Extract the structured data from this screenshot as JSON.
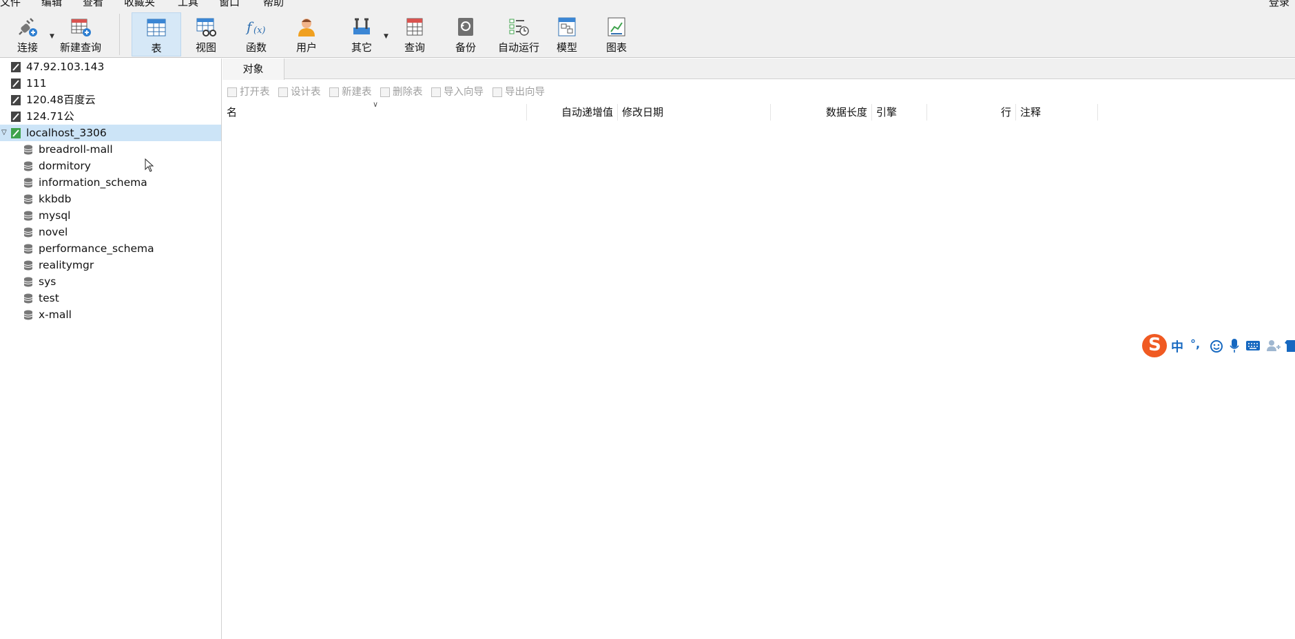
{
  "menu": {
    "items": [
      "文件",
      "编辑",
      "查看",
      "收藏夹",
      "工具",
      "窗口",
      "帮助"
    ],
    "login": "登录"
  },
  "toolbar": {
    "connect": "连接",
    "new_query": "新建查询",
    "table": "表",
    "view": "视图",
    "function": "函数",
    "user": "用户",
    "other": "其它",
    "query": "查询",
    "backup": "备份",
    "auto_run": "自动运行",
    "model": "模型",
    "chart": "图表"
  },
  "sidebar": {
    "connections": [
      "47.92.103.143",
      "111",
      "120.48百度云",
      "124.71公"
    ],
    "active_connection": "localhost_3306",
    "databases": [
      "breadroll-mall",
      "dormitory",
      "information_schema",
      "kkbdb",
      "mysql",
      "novel",
      "performance_schema",
      "realitymgr",
      "sys",
      "test",
      "x-mall"
    ]
  },
  "main": {
    "tab_label": "对象",
    "object_tools": [
      "打开表",
      "设计表",
      "新建表",
      "删除表",
      "导入向导",
      "导出向导"
    ],
    "columns": [
      "名",
      "自动递增值",
      "修改日期",
      "数据长度",
      "引擎",
      "行",
      "注释"
    ]
  },
  "ime": {
    "mode": "中",
    "punct": "°,"
  },
  "colors": {
    "accent_selection": "#cce4f7",
    "toolbar_bg": "#f0f0f0",
    "ime_logo": "#f05a22",
    "active_conn_icon": "#3fa34d"
  }
}
